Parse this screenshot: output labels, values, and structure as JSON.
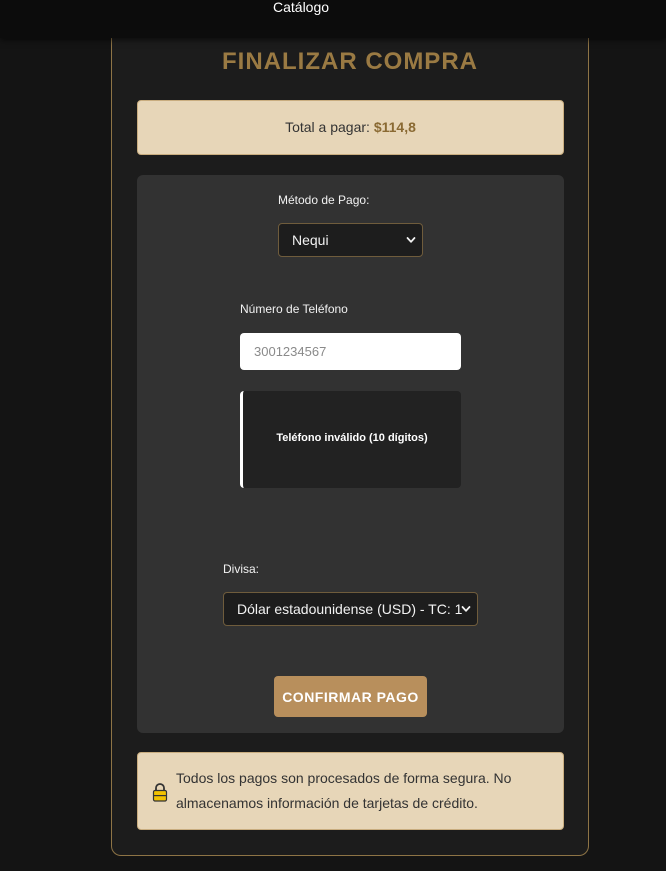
{
  "nav": {
    "catalog_label": "Catálogo"
  },
  "checkout": {
    "title": "FINALIZAR COMPRA",
    "total_label": "Total a pagar: ",
    "total_amount": "$114,8"
  },
  "form": {
    "payment_method_label": "Método de Pago:",
    "payment_method_value": "Nequi",
    "phone_label": "Número de Teléfono",
    "phone_placeholder": "3001234567",
    "phone_value": "",
    "phone_error": "Teléfono inválido (10 dígitos)",
    "currency_label": "Divisa:",
    "currency_value": "Dólar estadounidense (USD) - TC: 1",
    "confirm_label": "CONFIRMAR PAGO"
  },
  "security": {
    "icon": "lock-icon",
    "message": "Todos los pagos son procesados de forma segura. No almacenamos información de tarjetas de crédito."
  },
  "colors": {
    "accent": "#b88f5c",
    "title_gold": "#9a7a43",
    "panel_bg": "#323232",
    "info_bg": "#e7d6b8"
  }
}
